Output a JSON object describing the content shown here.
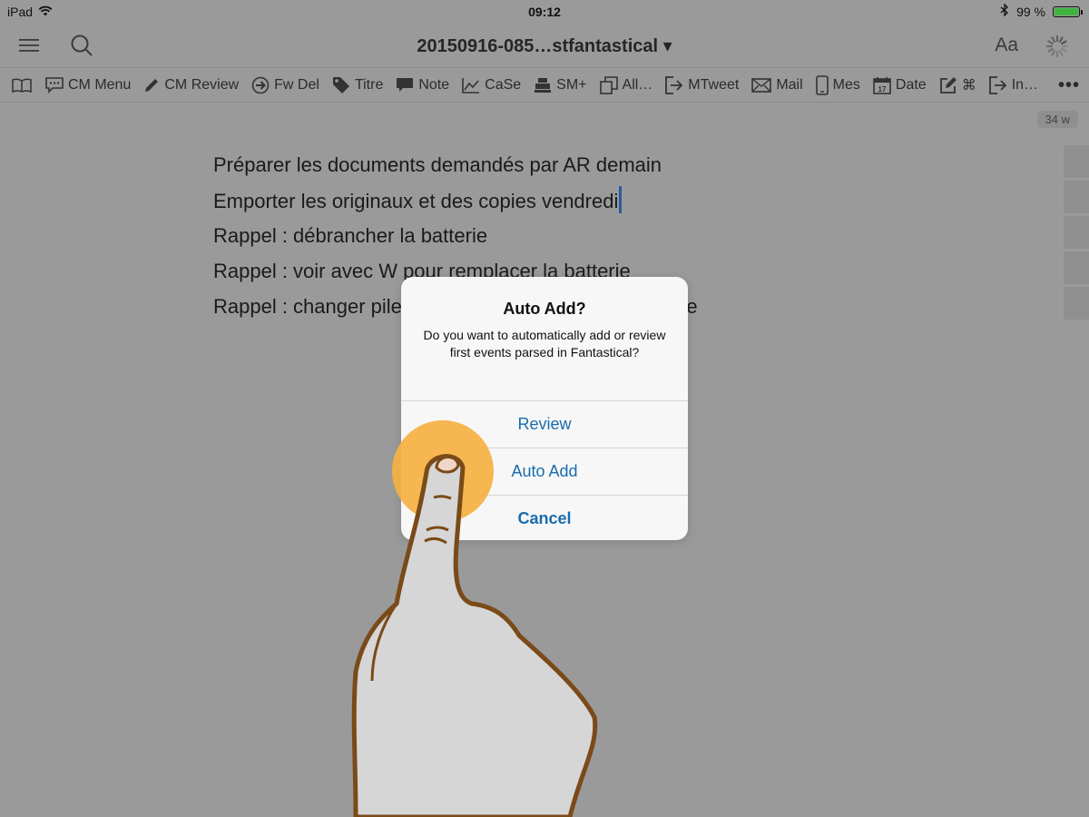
{
  "status_bar": {
    "device": "iPad",
    "time": "09:12",
    "battery_text": "99 %",
    "battery_level": 0.99,
    "battery_color": "#3fb23f"
  },
  "nav": {
    "title": "20150916-085…stfantastical ▾",
    "font_button": "Aa"
  },
  "toolbar": {
    "items": [
      {
        "label": "CM Menu",
        "icon": "speech-bubble-icon"
      },
      {
        "label": "CM Review",
        "icon": "pencil-icon"
      },
      {
        "label": "Fw Del",
        "icon": "arrow-circle-icon"
      },
      {
        "label": "Titre",
        "icon": "tag-icon"
      },
      {
        "label": "Note",
        "icon": "chat-bubble-icon"
      },
      {
        "label": "CaSe",
        "icon": "line-chart-icon"
      },
      {
        "label": "SM+",
        "icon": "cash-register-icon"
      },
      {
        "label": "All…",
        "icon": "copy-icon"
      },
      {
        "label": "MTweet",
        "icon": "share-arrow-icon"
      },
      {
        "label": "Mail",
        "icon": "envelope-icon"
      },
      {
        "label": "Mes",
        "icon": "phone-icon"
      },
      {
        "label": "Date",
        "icon": "calendar-icon"
      },
      {
        "label": "⌘",
        "icon": "edit-icon"
      },
      {
        "label": "In…",
        "icon": "share-arrow-icon"
      }
    ],
    "more": "•••"
  },
  "word_count": "34 w",
  "document": {
    "lines": [
      "Préparer les documents demandés par AR demain",
      "Emporter les originaux et des copies vendredi",
      "Rappel : débrancher la batterie",
      "Rappel : voir avec W pour remplacer la batterie",
      "Rappel : changer pile"
    ],
    "line5_tail": "re"
  },
  "alert": {
    "title": "Auto Add?",
    "message": "Do you want to automatically add or review first events parsed in Fantastical?",
    "buttons": {
      "review": "Review",
      "auto_add": "Auto Add",
      "cancel": "Cancel"
    },
    "button_color": "#1a6cad"
  },
  "touch_indicator_color": "#f5b043"
}
